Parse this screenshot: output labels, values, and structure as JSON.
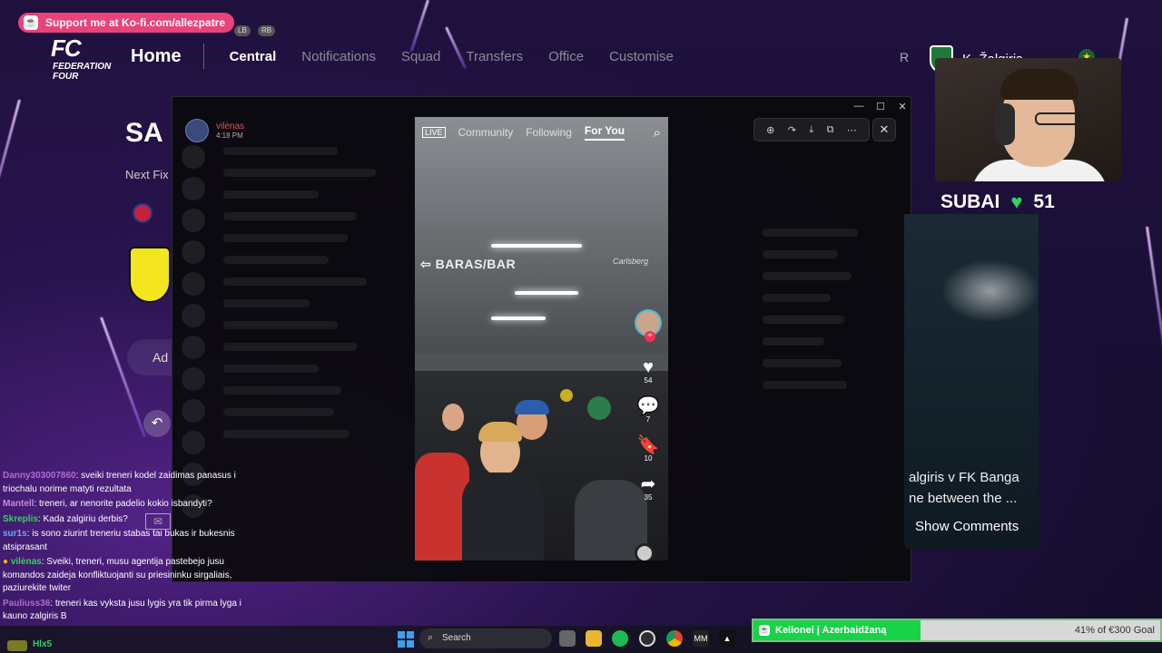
{
  "kofi_banner": {
    "text": "Support me at Ko-fi.com/allezpatre"
  },
  "controller_hints": {
    "lb": "LB",
    "rb": "RB"
  },
  "logo": {
    "top": "FC",
    "bottom": "FEDERATION FOUR"
  },
  "nav": {
    "home": "Home",
    "items": [
      "Central",
      "Notifications",
      "Squad",
      "Transfers",
      "Office",
      "Customise"
    ]
  },
  "club": {
    "name": "K. Žalgiris"
  },
  "background_page": {
    "title_fragment": "SA",
    "next_fixture_fragment": "Next Fix",
    "advance_fragment": "Ad"
  },
  "popup_post": {
    "author": "vilėnas",
    "time": "4:18 PM"
  },
  "tiktok": {
    "tabs": [
      "Community",
      "Following",
      "For You"
    ],
    "active_tab": "For You",
    "live_label": "LIVE",
    "sign_text": "BARAS/BAR",
    "sign_brand": "Carlsberg",
    "likes": "54",
    "comments": "7",
    "bookmarks": "10",
    "shares": "35"
  },
  "webcam_overlay": {
    "name": "SUBAI",
    "count": "51",
    "heart_color": "#2ed45d"
  },
  "match_panel": {
    "line1": "algiris v FK Banga",
    "line2": "ne between the ...",
    "show_comments": "Show Comments"
  },
  "chat": [
    {
      "user": "Danny303007860",
      "color": "#b06ad6",
      "text": ": sveiki treneri kodel zaidimas panasus i triochalu norime matyti rezultata"
    },
    {
      "user": "Mantell",
      "color": "#c48bd8",
      "text": ": treneri, ar nenorite padelio kokio isbandyti?"
    },
    {
      "user": "Skreplis",
      "color": "#3ccf5c",
      "text": ": Kada zalgiriu derbis?"
    },
    {
      "user": "sur1s",
      "color": "#6aa8ff",
      "text": ": is sono ziurint treneriu stabas tai bukas ir bukesnis atsiprasant"
    },
    {
      "user": "vilėnas",
      "color": "#2ed45d",
      "text": ": Sveiki, treneri, musu agentija pastebejo jusu komandos zaideja konfliktuojanti su priesininku sirgaliais, paziurekite twiter"
    },
    {
      "user": "Pauliuss36",
      "color": "#b06ad6",
      "text": ": treneri kas vyksta jusu lygis yra tik pirma lyga i kauno zalgiris B"
    }
  ],
  "chat_partial": "Hlx5",
  "taskbar": {
    "search_placeholder": "Search"
  },
  "goal": {
    "label": "Kelionei į Azerbaidžaną",
    "amount_text": "41% of €300 Goal",
    "progress_fraction": 0.41,
    "fill_color": "#18d248"
  }
}
